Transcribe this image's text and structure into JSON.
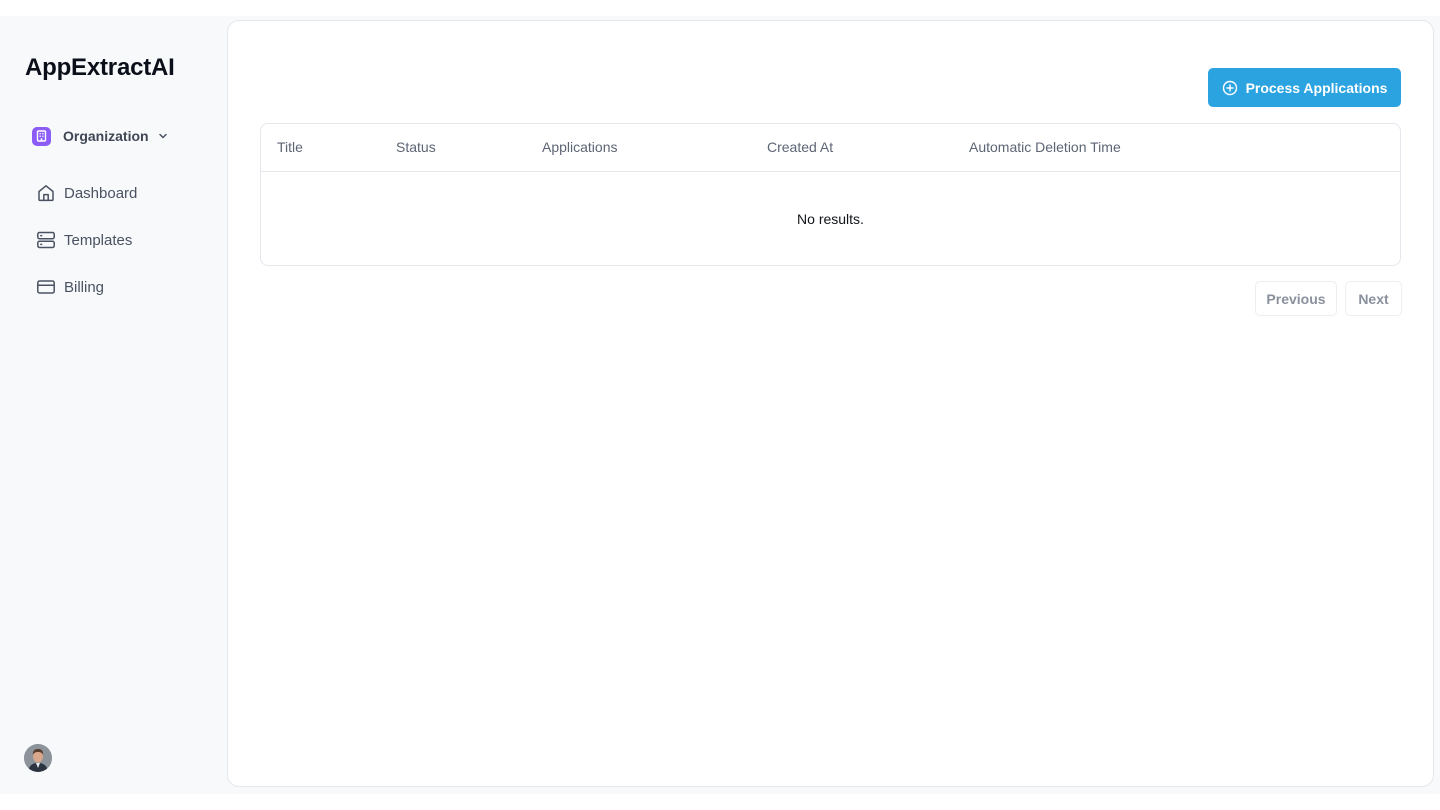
{
  "app": {
    "title": "AppExtractAI"
  },
  "organization": {
    "label": "Organization",
    "badge_color": "#8b5cf6",
    "icon": "building-icon"
  },
  "sidebar": {
    "items": [
      {
        "label": "Dashboard",
        "icon": "home-icon"
      },
      {
        "label": "Templates",
        "icon": "server-icon"
      },
      {
        "label": "Billing",
        "icon": "credit-card-icon"
      }
    ]
  },
  "toolbar": {
    "process_label": "Process Applications",
    "process_icon": "plus-circle-icon",
    "accent_color": "#2ba3e0"
  },
  "table": {
    "columns": [
      "Title",
      "Status",
      "Applications",
      "Created At",
      "Automatic Deletion Time"
    ],
    "empty_message": "No results."
  },
  "pagination": {
    "previous_label": "Previous",
    "next_label": "Next"
  }
}
